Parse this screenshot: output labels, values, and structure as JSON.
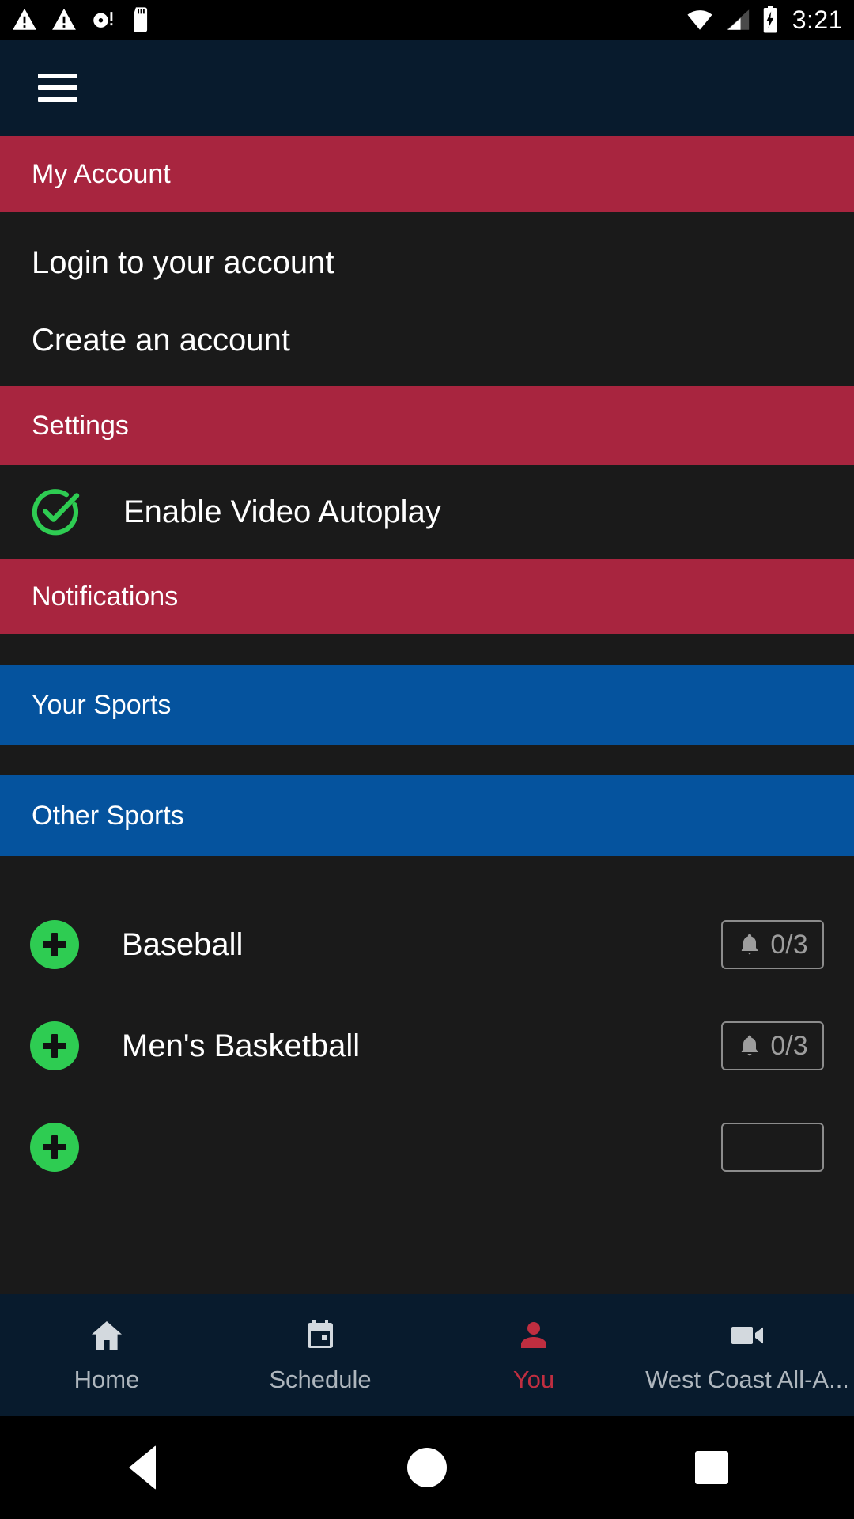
{
  "status_bar": {
    "icons_left": [
      "warning-triangle-icon",
      "warning-triangle-icon",
      "disc-alert-icon",
      "sd-card-icon"
    ],
    "icons_right": [
      "wifi-icon",
      "cell-signal-icon",
      "battery-charging-icon"
    ],
    "time": "3:21"
  },
  "app_bar": {
    "menu_icon": "hamburger-menu-icon"
  },
  "sections": {
    "my_account": {
      "title": "My Account",
      "items": [
        {
          "label": "Login to your account"
        },
        {
          "label": "Create an account"
        }
      ]
    },
    "settings": {
      "title": "Settings",
      "autoplay": {
        "label": "Enable Video Autoplay",
        "checked": true,
        "icon": "check-circle-icon"
      }
    },
    "notifications": {
      "title": "Notifications"
    },
    "your_sports": {
      "title": "Your Sports",
      "items": []
    },
    "other_sports": {
      "title": "Other Sports",
      "items": [
        {
          "label": "Baseball",
          "add_icon": "plus-circle-icon",
          "notify_icon": "bell-icon",
          "notify_count": "0/3"
        },
        {
          "label": "Men's Basketball",
          "add_icon": "plus-circle-icon",
          "notify_icon": "bell-icon",
          "notify_count": "0/3"
        }
      ]
    }
  },
  "tab_bar": {
    "tabs": [
      {
        "label": "Home",
        "icon": "home-icon",
        "active": false
      },
      {
        "label": "Schedule",
        "icon": "calendar-icon",
        "active": false
      },
      {
        "label": "You",
        "icon": "person-icon",
        "active": true
      },
      {
        "label": "West Coast All-A...",
        "icon": "video-camera-icon",
        "active": false
      }
    ]
  },
  "android_nav": {
    "back": "back-triangle-icon",
    "home": "home-circle-icon",
    "recents": "recents-square-icon"
  },
  "colors": {
    "header_navy": "#081b2d",
    "section_red": "#a8253f",
    "section_blue": "#05539e",
    "body_dark": "#1a1a1a",
    "accent_green": "#2ecc52",
    "active_red": "#bf2e40",
    "muted_gray": "#9d9d9d"
  }
}
